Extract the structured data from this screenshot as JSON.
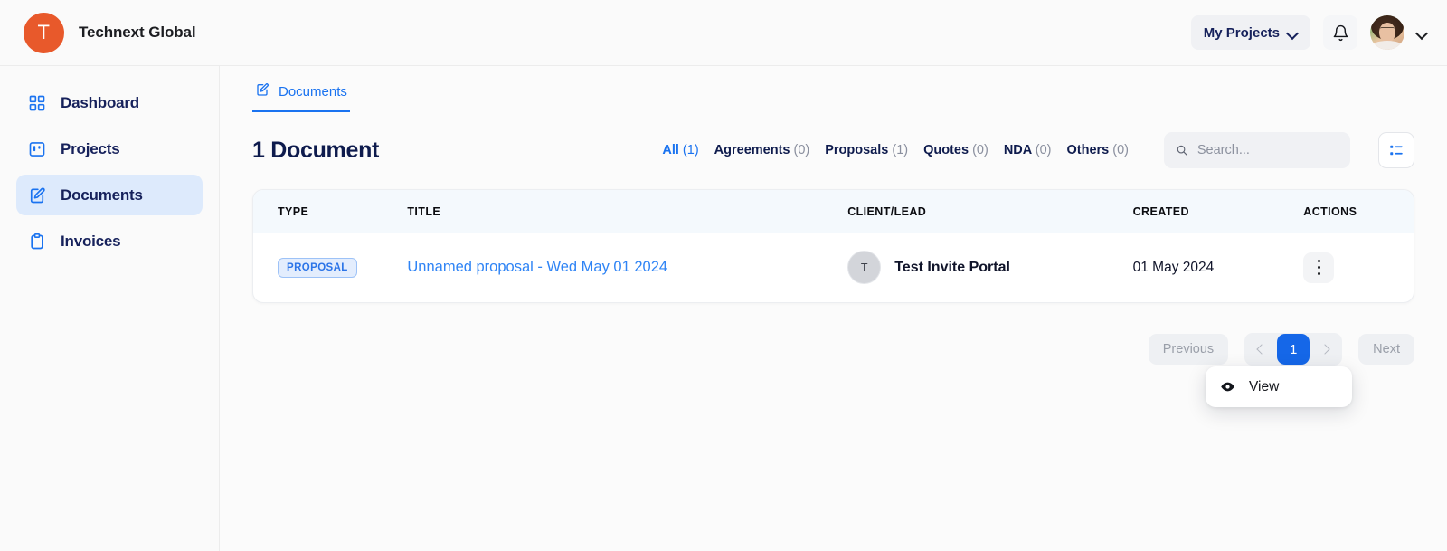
{
  "topbar": {
    "logo_letter": "T",
    "brand_name": "Technext Global",
    "projects_button": "My Projects",
    "bell_icon": "bell-icon",
    "avatar_chevron": "chevron-down-icon"
  },
  "sidebar": {
    "items": [
      {
        "label": "Dashboard",
        "icon": "grid-icon",
        "active": false
      },
      {
        "label": "Projects",
        "icon": "kanban-icon",
        "active": false
      },
      {
        "label": "Documents",
        "icon": "document-edit-icon",
        "active": true
      },
      {
        "label": "Invoices",
        "icon": "clipboard-icon",
        "active": false
      }
    ]
  },
  "main": {
    "tab": {
      "label": "Documents",
      "icon": "document-edit-icon"
    },
    "page_title": "1 Document",
    "filters": [
      {
        "label": "All",
        "count": "(1)",
        "active": true
      },
      {
        "label": "Agreements",
        "count": "(0)",
        "active": false
      },
      {
        "label": "Proposals",
        "count": "(1)",
        "active": false
      },
      {
        "label": "Quotes",
        "count": "(0)",
        "active": false
      },
      {
        "label": "NDA",
        "count": "(0)",
        "active": false
      },
      {
        "label": "Others",
        "count": "(0)",
        "active": false
      }
    ],
    "search": {
      "placeholder": "Search...",
      "value": "",
      "icon": "search-icon"
    },
    "view_toggle_icon": "list-view-icon",
    "table": {
      "columns": [
        "TYPE",
        "TITLE",
        "CLIENT/LEAD",
        "CREATED",
        "ACTIONS"
      ],
      "rows": [
        {
          "type": "PROPOSAL",
          "title": "Unnamed proposal - Wed May 01 2024",
          "client_initial": "T",
          "client": "Test Invite Portal",
          "created": "01 May 2024",
          "actions_icon": "kebab-menu-icon"
        }
      ]
    },
    "dropdown": {
      "items": [
        {
          "label": "View",
          "icon": "eye-icon"
        }
      ]
    },
    "pagination": {
      "previous": "Previous",
      "next": "Next",
      "current_page": "1",
      "prev_arrow_icon": "chevron-left-icon",
      "next_arrow_icon": "chevron-right-icon"
    }
  },
  "colors": {
    "brand_orange": "#e8592b",
    "accent_blue": "#1a73f0",
    "navy": "#0e1b4d",
    "active_nav_bg": "#ddeafc",
    "table_head_bg": "#f4f9fd",
    "badge_bg": "#e3edfd",
    "badge_text": "#2b74e8",
    "page_active_bg": "#1567e8"
  }
}
